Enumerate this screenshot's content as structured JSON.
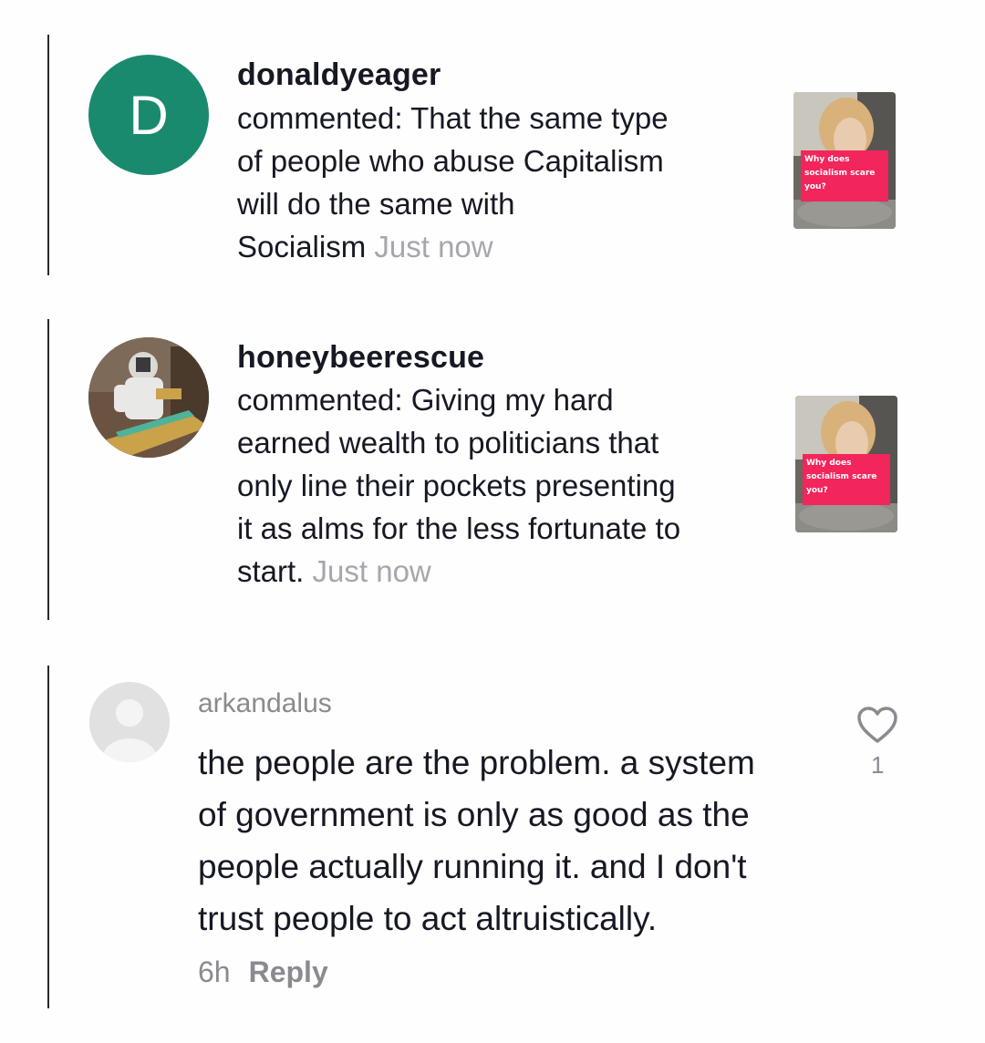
{
  "notifications": [
    {
      "username": "donaldyeager",
      "avatar_letter": "D",
      "avatar_color": "#1a8a6e",
      "lines": [
        "commented: That the same type",
        "of people who abuse Capitalism",
        "will do the same with"
      ],
      "last_line": "Socialism",
      "time": "Just now",
      "thumbnail_caption": "Why does socialism scare you?"
    },
    {
      "username": "honeybeerescue",
      "avatar_icon": "beekeeper-photo",
      "lines": [
        "commented: Giving my hard",
        "earned wealth to politicians that",
        "only line their pockets presenting",
        "it as alms for the less fortunate to"
      ],
      "last_line": "start.",
      "time": "Just now",
      "thumbnail_caption": "Why does socialism scare you?"
    }
  ],
  "comment": {
    "username": "arkandalus",
    "avatar_icon": "default-avatar-icon",
    "lines": [
      "the people are the problem. a system",
      "of government is only as good as the",
      "people actually running it. and I don't",
      "trust people to act altruistically."
    ],
    "time": "6h",
    "reply_label": "Reply",
    "like_icon": "heart-outline-icon",
    "like_count": "1"
  },
  "colors": {
    "accent_thumb": "#f2255c",
    "muted_text": "#a6a6ad"
  }
}
